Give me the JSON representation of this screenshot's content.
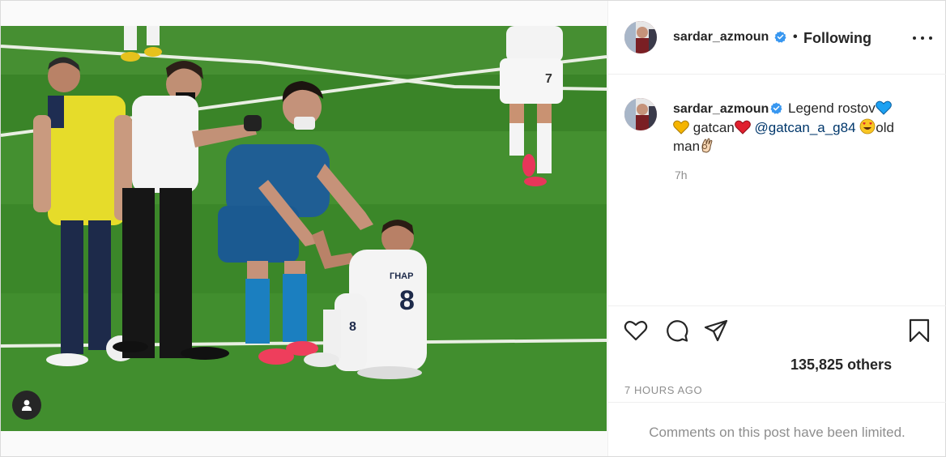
{
  "post": {
    "username": "sardar_azmoun",
    "follow_status": "Following",
    "separator": "•",
    "caption": {
      "username": "sardar_azmoun",
      "part1": "Legend rostov",
      "part2": "gatcan",
      "mention": "@gatcan_a_g84",
      "part3": "old",
      "part4": "man"
    },
    "caption_age": "7h",
    "likes_text": "135,825 others",
    "timestamp": "7 HOURS AGO",
    "comments_notice": "Comments on this post have been limited."
  },
  "icons": {
    "verified": "verified-badge-icon",
    "more": "more-options-icon",
    "like": "heart-icon",
    "comment": "comment-icon",
    "share": "share-icon",
    "save": "bookmark-icon",
    "tag": "user-tag-icon"
  },
  "colors": {
    "verified": "#3897f0",
    "mention": "#00376b",
    "muted": "#8e8e8e",
    "text": "#262626",
    "pitch": "#3f8a2c"
  }
}
